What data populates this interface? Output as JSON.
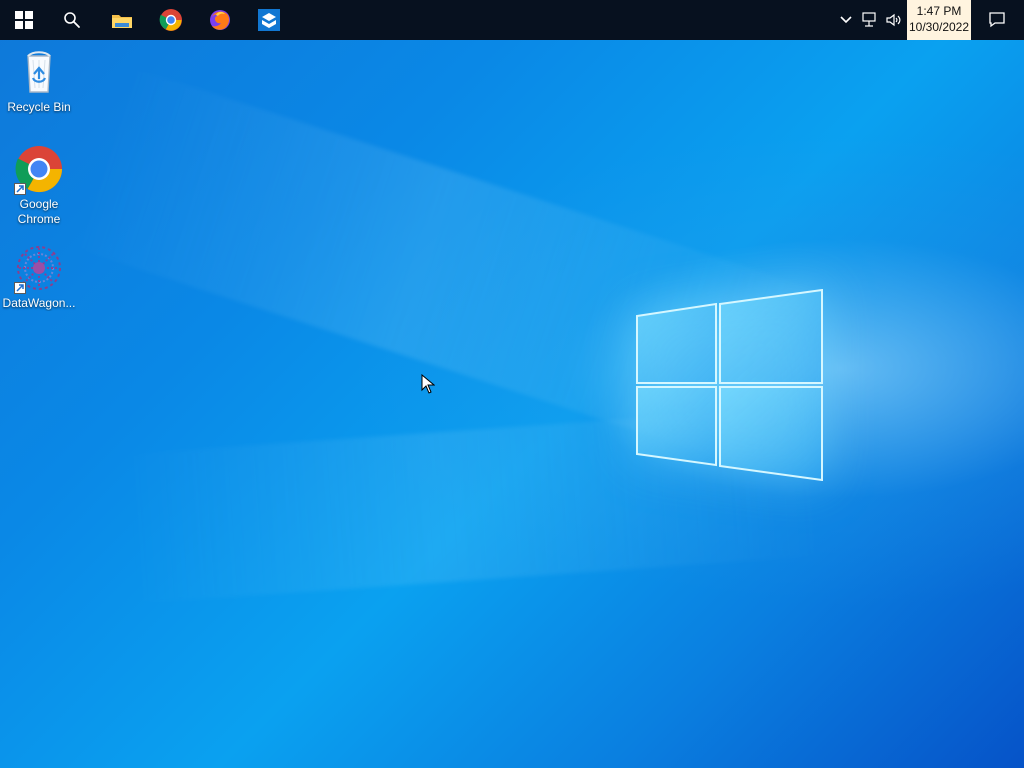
{
  "taskbar": {
    "apps": [
      {
        "name": "start",
        "icon": "windows-icon"
      },
      {
        "name": "search",
        "icon": "search-icon"
      },
      {
        "name": "file-explorer",
        "icon": "folder-icon"
      },
      {
        "name": "google-chrome",
        "icon": "chrome-icon"
      },
      {
        "name": "firefox",
        "icon": "firefox-icon"
      },
      {
        "name": "datawagon",
        "icon": "datawagon-icon"
      }
    ],
    "tray": {
      "time": "1:47 PM",
      "date": "10/30/2022",
      "icons": [
        "chevron-up-icon",
        "network-icon",
        "volume-icon",
        "notification-icon"
      ]
    }
  },
  "desktop": {
    "icons": [
      {
        "label": "Recycle Bin",
        "icon": "recycle-bin-icon"
      },
      {
        "label": "Google Chrome",
        "icon": "chrome-icon"
      },
      {
        "label": "DataWagon...",
        "icon": "datawagon-icon"
      }
    ]
  },
  "colors": {
    "taskbar": "#07111f",
    "desktop_blue": "#0aa1f0",
    "desktop_dark_blue": "#0653c8",
    "clock_background": "#fff4df",
    "text_light": "#ffffff",
    "text_dark": "#111111"
  }
}
